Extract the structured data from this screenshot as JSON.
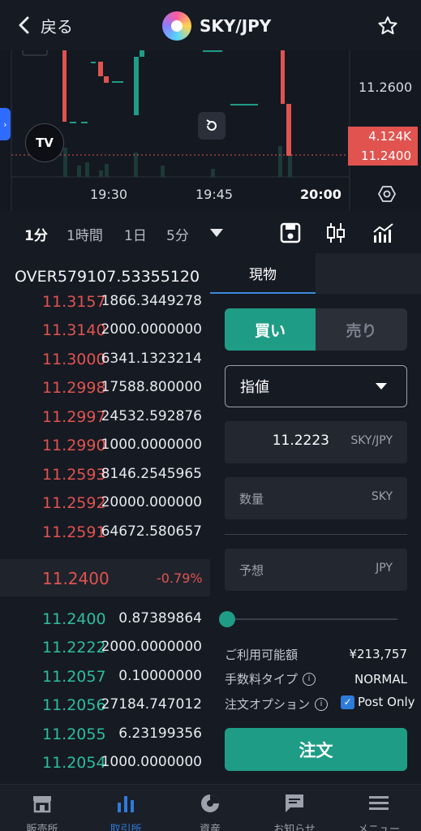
{
  "header": {
    "back_label": "戻る",
    "pair": "SKY/JPY"
  },
  "chart": {
    "axis_price": "11.2600",
    "volume_tag": "4.124K",
    "price_tag": "11.2400",
    "time_labels": [
      "19:30",
      "19:45",
      "20:00"
    ]
  },
  "timeframes": {
    "items": [
      "1分",
      "1時間",
      "1日",
      "5分"
    ],
    "active": "1分"
  },
  "orderbook": {
    "over_label": "OVER579107.53355120",
    "asks": [
      {
        "price": "11.3157",
        "amount": "1866.3449278"
      },
      {
        "price": "11.3140",
        "amount": "2000.0000000"
      },
      {
        "price": "11.3000",
        "amount": "6341.1323214"
      },
      {
        "price": "11.2998",
        "amount": "17588.800000"
      },
      {
        "price": "11.2997",
        "amount": "24532.592876"
      },
      {
        "price": "11.2990",
        "amount": "1000.0000000"
      },
      {
        "price": "11.2593",
        "amount": "8146.2545965"
      },
      {
        "price": "11.2592",
        "amount": "20000.000000"
      },
      {
        "price": "11.2591",
        "amount": "64672.580657"
      }
    ],
    "last_price": "11.2400",
    "change_pct": "-0.79%",
    "bids": [
      {
        "price": "11.2400",
        "amount": "0.87389864"
      },
      {
        "price": "11.2222",
        "amount": "2000.0000000"
      },
      {
        "price": "11.2057",
        "amount": "0.10000000"
      },
      {
        "price": "11.2056",
        "amount": "27184.747012"
      },
      {
        "price": "11.2055",
        "amount": "6.23199356"
      },
      {
        "price": "11.2054",
        "amount": "1000.0000000"
      }
    ]
  },
  "order_panel": {
    "tab_spot": "現物",
    "buy_label": "買い",
    "sell_label": "売り",
    "order_type": "指値",
    "price_value": "11.2223",
    "price_unit": "SKY/JPY",
    "qty_label": "数量",
    "qty_unit": "SKY",
    "estimate_label": "予想",
    "estimate_unit": "JPY",
    "available_label": "ご利用可能額",
    "available_value": "¥213,757",
    "fee_label": "手数料タイプ",
    "fee_value": "NORMAL",
    "option_label": "注文オプション",
    "post_only_label": "Post Only",
    "post_only_checked": true,
    "submit_label": "注文",
    "slider_percent": 0
  },
  "bottom_nav": {
    "items": [
      "販売所",
      "取引所",
      "資産",
      "お知らせ",
      "メニュー"
    ],
    "active": "取引所"
  },
  "colors": {
    "accent_green": "#1f9c86",
    "ask_red": "#e0534f",
    "bid_green": "#2dbd9e",
    "link_blue": "#2f7bd9"
  }
}
